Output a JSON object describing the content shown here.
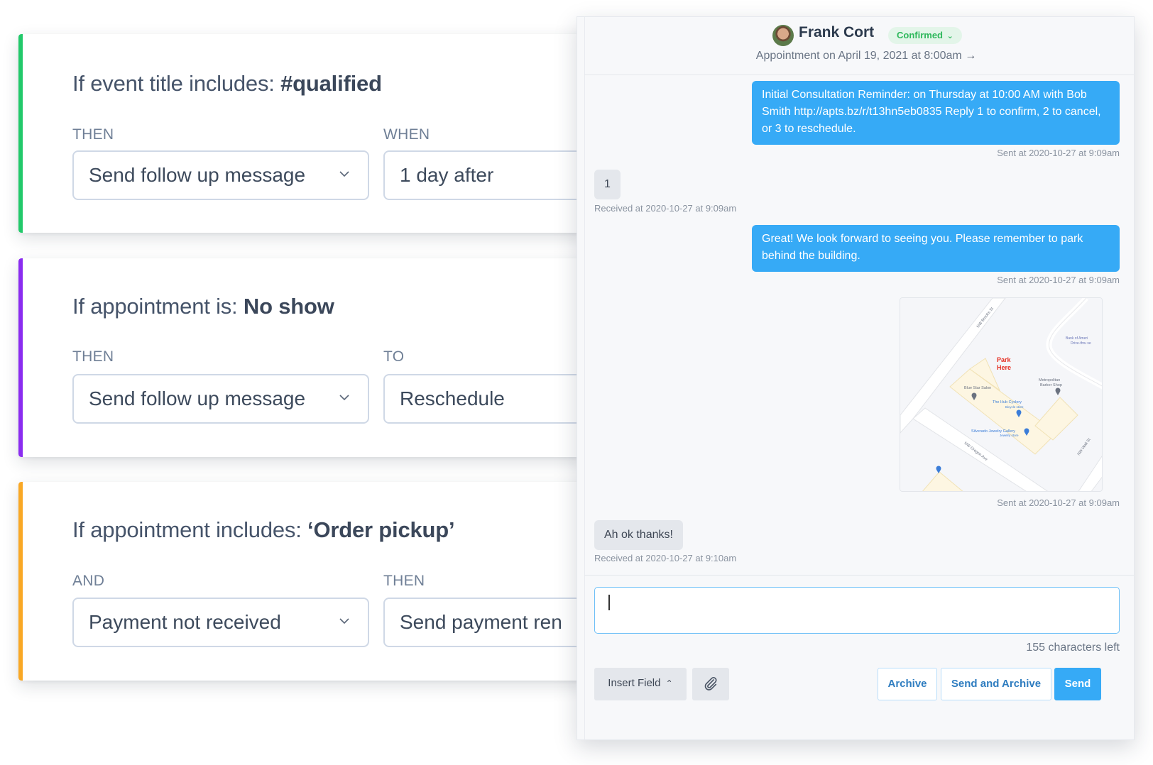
{
  "rules": [
    {
      "accent_color": "#22c96a",
      "title_prefix": "If event title includes: ",
      "title_value": "#qualified",
      "left_label": "THEN",
      "left_value": "Send follow up message",
      "right_label": "WHEN",
      "right_value": "1 day after"
    },
    {
      "accent_color": "#8a2cf0",
      "title_prefix": "If appointment is: ",
      "title_value": "No show",
      "left_label": "THEN",
      "left_value": "Send follow up message",
      "right_label": "TO",
      "right_value": "Reschedule"
    },
    {
      "accent_color": "#f9a825",
      "title_prefix": "If appointment includes: ",
      "title_value": "‘Order pickup’",
      "left_label": "AND",
      "left_value": "Payment not received",
      "right_label": "THEN",
      "right_value": "Send payment ren"
    }
  ],
  "conversation": {
    "contact_name": "Frank Cort",
    "status": "Confirmed",
    "status_chevron": "⌄",
    "appointment": "Appointment on April 19, 2021 at  8:00am",
    "appointment_arrow": "→",
    "colors": {
      "sent_bubble": "#36aaf6",
      "received_bubble": "#e4e7ec",
      "status_green": "#2fb85c"
    },
    "messages": [
      {
        "direction": "sent",
        "text": "Initial Consultation Reminder: on Thursday at 10:00 AM with Bob Smith http://apts.bz/r/t13hn5eb0835 Reply 1 to confirm, 2 to cancel, or 3 to reschedule.",
        "meta": "Sent at 2020-10-27 at 9:09am"
      },
      {
        "direction": "received",
        "text": "1",
        "meta": "Received at 2020-10-27 at 9:09am"
      },
      {
        "direction": "sent",
        "text": "Great! We look forward to seeing you. Please remember to park behind the building.",
        "meta": "Sent at 2020-10-27 at 9:09am"
      },
      {
        "direction": "sent",
        "type": "map-image",
        "meta": "Sent at 2020-10-27 at 9:09am",
        "map_labels": {
          "park_here_1": "Park",
          "park_here_2": "Here",
          "street_1": "NW Brooks St",
          "street_2": "NW Oregon Ave",
          "street_3": "NW Wall St",
          "poi_1": "Blue Star Salon",
          "poi_2a": "The Hub Cyclery",
          "poi_2b": "Bicycle store",
          "poi_3a": "Silverado Jewelry Gallery",
          "poi_3b": "Jewelry store",
          "poi_4a": "Metropolitan",
          "poi_4b": "Barber Shop",
          "poi_5a": "Bank of Ameri",
          "poi_5b": "Drive-thru se"
        }
      },
      {
        "direction": "received",
        "text": "Ah ok thanks!",
        "meta": "Received at 2020-10-27 at 9:10am"
      }
    ]
  },
  "composer": {
    "value": "",
    "chars_left": "155 characters left",
    "insert_field_label": "Insert Field",
    "insert_field_chevron": "⌃",
    "archive_label": "Archive",
    "send_and_archive_label": "Send and Archive",
    "send_label": "Send"
  }
}
